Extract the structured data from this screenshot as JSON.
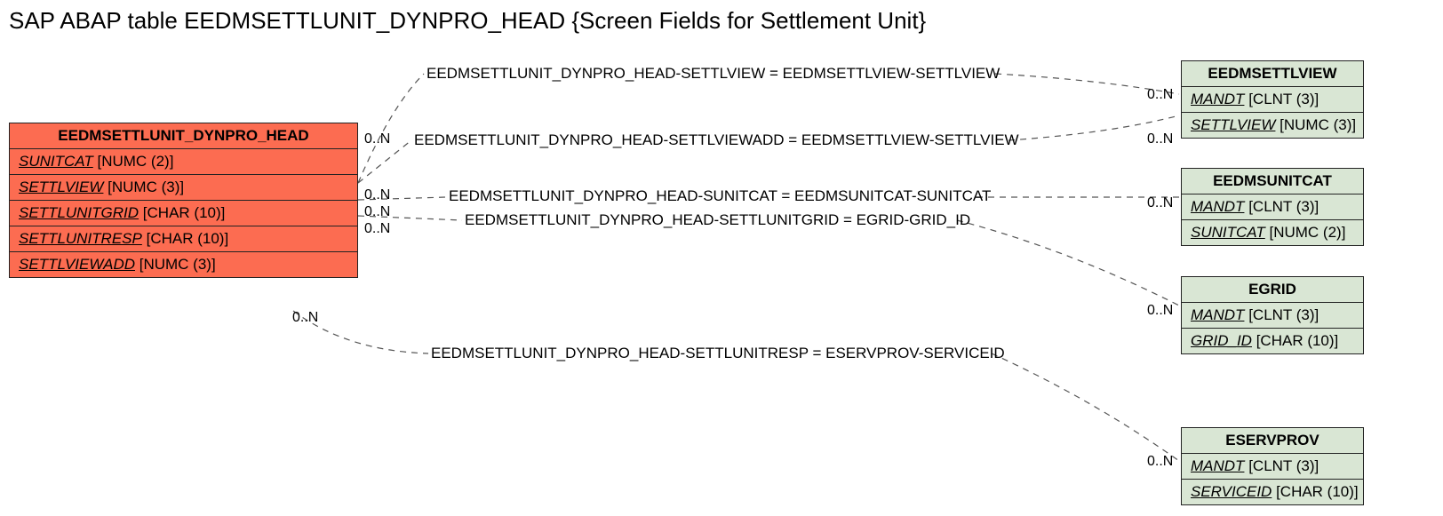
{
  "title": "SAP ABAP table EEDMSETTLUNIT_DYNPRO_HEAD {Screen Fields for Settlement Unit}",
  "main_entity": {
    "name": "EEDMSETTLUNIT_DYNPRO_HEAD",
    "fields": [
      {
        "name": "SUNITCAT",
        "type": "[NUMC (2)]"
      },
      {
        "name": "SETTLVIEW",
        "type": "[NUMC (3)]"
      },
      {
        "name": "SETTLUNITGRID",
        "type": "[CHAR (10)]"
      },
      {
        "name": "SETTLUNITRESP",
        "type": "[CHAR (10)]"
      },
      {
        "name": "SETTLVIEWADD",
        "type": "[NUMC (3)]"
      }
    ]
  },
  "ref_entities": [
    {
      "name": "EEDMSETTLVIEW",
      "fields": [
        {
          "name": "MANDT",
          "type": "[CLNT (3)]"
        },
        {
          "name": "SETTLVIEW",
          "type": "[NUMC (3)]"
        }
      ]
    },
    {
      "name": "EEDMSUNITCAT",
      "fields": [
        {
          "name": "MANDT",
          "type": "[CLNT (3)]"
        },
        {
          "name": "SUNITCAT",
          "type": "[NUMC (2)]"
        }
      ]
    },
    {
      "name": "EGRID",
      "fields": [
        {
          "name": "MANDT",
          "type": "[CLNT (3)]"
        },
        {
          "name": "GRID_ID",
          "type": "[CHAR (10)]"
        }
      ]
    },
    {
      "name": "ESERVPROV",
      "fields": [
        {
          "name": "MANDT",
          "type": "[CLNT (3)]"
        },
        {
          "name": "SERVICEID",
          "type": "[CHAR (10)]"
        }
      ]
    }
  ],
  "relations": [
    {
      "label": "EEDMSETTLUNIT_DYNPRO_HEAD-SETTLVIEW = EEDMSETTLVIEW-SETTLVIEW",
      "left_mult": "0..N",
      "right_mult": "0..N"
    },
    {
      "label": "EEDMSETTLUNIT_DYNPRO_HEAD-SETTLVIEWADD = EEDMSETTLVIEW-SETTLVIEW",
      "left_mult": "0..N",
      "right_mult": "0..N"
    },
    {
      "label": "EEDMSETTLUNIT_DYNPRO_HEAD-SUNITCAT = EEDMSUNITCAT-SUNITCAT",
      "left_mult": "0..N",
      "right_mult": "0..N"
    },
    {
      "label": "EEDMSETTLUNIT_DYNPRO_HEAD-SETTLUNITGRID = EGRID-GRID_ID",
      "left_mult": "0..N",
      "right_mult": "0..N"
    },
    {
      "label": "EEDMSETTLUNIT_DYNPRO_HEAD-SETTLUNITRESP = ESERVPROV-SERVICEID",
      "left_mult": "0..N",
      "right_mult": "0..N"
    }
  ],
  "bottom_left_mult": "0..N"
}
